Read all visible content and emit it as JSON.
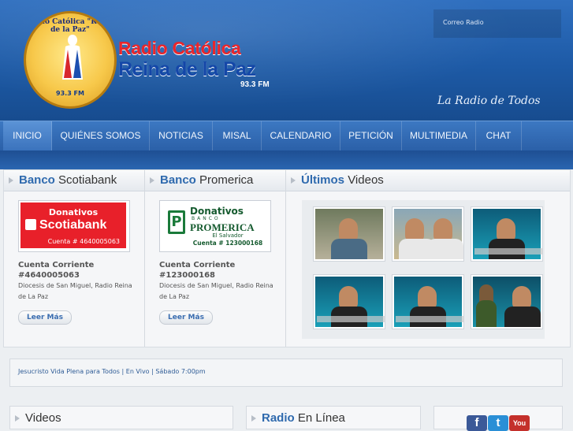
{
  "header": {
    "seal_ring_text": "Radio Católica \"Reina de la Paz\"",
    "seal_freq": "93.3 FM",
    "brand_line1": "Radio Católica",
    "brand_line2": "Reina de la Paz",
    "brand_freq": "93.3 FM",
    "correo_label": "Correo Radio",
    "tagline": "La Radio de Todos"
  },
  "nav": {
    "items": [
      {
        "label": "INICIO",
        "active": true
      },
      {
        "label": "QUIÉNES SOMOS"
      },
      {
        "label": "NOTICIAS"
      },
      {
        "label": "MISAL"
      },
      {
        "label": "CALENDARIO"
      },
      {
        "label": "PETICIÓN"
      },
      {
        "label": "MULTIMEDIA"
      },
      {
        "label": "CHAT"
      }
    ]
  },
  "banks": [
    {
      "head_bold": "Banco",
      "head_rest": "Scotiabank",
      "logo_title": "Donativos",
      "logo_name": "Scotiabank",
      "logo_account": "Cuenta # 4640005063",
      "account_title": "Cuenta Corriente #4640005063",
      "description": "Diocesis de San Miguel, Radio Reina de La Paz",
      "button": "Leer Más"
    },
    {
      "head_bold": "Banco",
      "head_rest": "Promerica",
      "logo_title": "Donativos",
      "logo_banco": "BANCO",
      "logo_name": "PROMERICA",
      "logo_country": "El Salvador",
      "logo_account": "Cuenta # 123000168",
      "account_title": "Cuenta Corriente #123000168",
      "description": "Diocesis de San Miguel, Radio Reina de La Paz",
      "button": "Leer Más"
    }
  ],
  "videos_section": {
    "head_bold": "Últimos",
    "head_rest": "Videos",
    "thumbs": [
      "video-1",
      "video-2",
      "video-3",
      "video-4",
      "video-5",
      "video-6"
    ]
  },
  "ticker": "Jesucristo Vida Plena para Todos | En Vivo | Sábado 7:00pm",
  "bottom": {
    "videos_title": "Videos",
    "radio_bold": "Radio",
    "radio_rest": "En Línea"
  },
  "social": [
    {
      "name": "facebook",
      "glyph": "f",
      "color": "#3b5998"
    },
    {
      "name": "twitter",
      "glyph": "t",
      "color": "#2a8fd6"
    },
    {
      "name": "youtube",
      "glyph": "You",
      "color": "#c4302b"
    }
  ]
}
